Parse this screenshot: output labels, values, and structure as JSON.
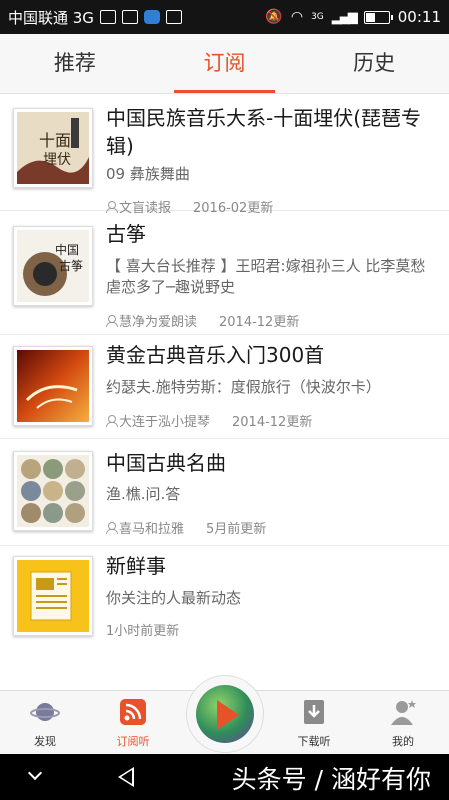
{
  "status_bar": {
    "carrier": "中国联通 3G",
    "network_tag": "3G",
    "time": "00:11",
    "battery_level": 0.45
  },
  "tabs": [
    {
      "label": "推荐",
      "active": false
    },
    {
      "label": "订阅",
      "active": true
    },
    {
      "label": "历史",
      "active": false
    }
  ],
  "colors": {
    "accent": "#e8512a",
    "text": "#1a1a1a",
    "subtext": "#666666",
    "meta": "#888888"
  },
  "subscriptions": [
    {
      "title": "中国民族音乐大系-十面埋伏(琵琶专辑)",
      "subtitle": "09 彝族舞曲",
      "author": "文盲读报",
      "updated": "2016-02更新",
      "cover_icon": "album-cover-pipa"
    },
    {
      "title": "古筝",
      "subtitle": "【 喜大台长推荐 】王昭君:嫁祖孙三人 比李莫愁虐恋多了─趣说野史",
      "author": "慧净为爱朗读",
      "updated": "2014-12更新",
      "cover_icon": "album-cover-guzheng"
    },
    {
      "title": "黄金古典音乐入门300首",
      "subtitle": "约瑟夫.施特劳斯：度假旅行（快波尔卡）",
      "author": "大连于泓小提琴",
      "updated": "2014-12更新",
      "cover_icon": "album-cover-classical"
    },
    {
      "title": "中国古典名曲",
      "subtitle": "渔.樵.问.答",
      "author": "喜马和拉雅",
      "updated": "5月前更新",
      "cover_icon": "album-cover-paintings"
    },
    {
      "title": "新鲜事",
      "subtitle": "你关注的人最新动态",
      "author": "",
      "updated": "1小时前更新",
      "cover_icon": "newspaper-icon"
    }
  ],
  "bottom_nav": [
    {
      "label": "发现",
      "icon": "planet-icon",
      "active": false
    },
    {
      "label": "订阅听",
      "icon": "rss-icon",
      "active": true
    },
    {
      "label": "下载听",
      "icon": "download-icon",
      "active": false
    },
    {
      "label": "我的",
      "icon": "user-icon",
      "active": false
    }
  ],
  "watermark": "头条号 / 涵好有你"
}
